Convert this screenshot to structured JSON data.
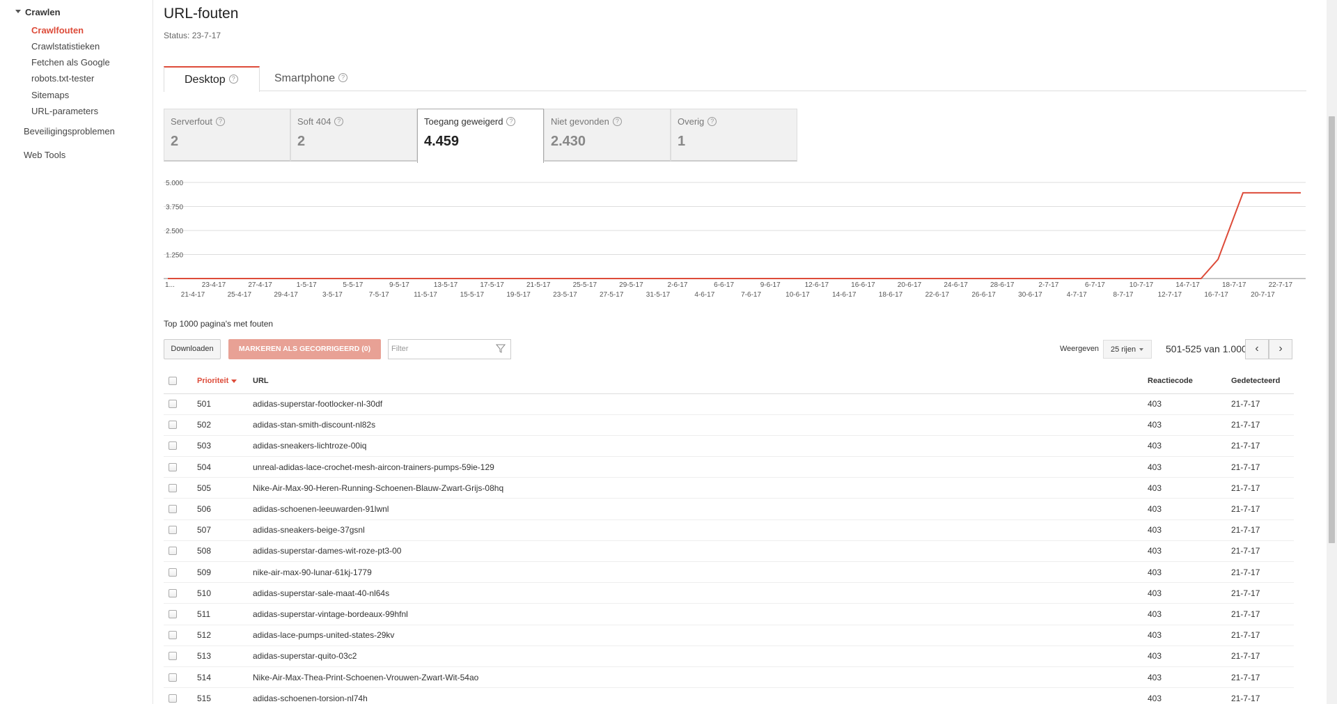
{
  "sidebar": {
    "group": "Crawlen",
    "items": [
      "Crawlfouten",
      "Crawlstatistieken",
      "Fetchen als Google",
      "robots.txt-tester",
      "Sitemaps",
      "URL-parameters"
    ],
    "security": "Beveiligingsproblemen",
    "webtools": "Web Tools"
  },
  "page": {
    "title": "URL-fouten",
    "status": "Status: 23-7-17"
  },
  "tabs": [
    {
      "label": "Desktop"
    },
    {
      "label": "Smartphone"
    }
  ],
  "cards": [
    {
      "label": "Serverfout",
      "value": "2"
    },
    {
      "label": "Soft 404",
      "value": "2"
    },
    {
      "label": "Toegang geweigerd",
      "value": "4.459"
    },
    {
      "label": "Niet gevonden",
      "value": "2.430"
    },
    {
      "label": "Overig",
      "value": "1"
    }
  ],
  "chart_data": {
    "type": "line",
    "ylim": [
      0,
      5000
    ],
    "yticks": [
      "5.000",
      "3.750",
      "2.500",
      "1.250"
    ],
    "x_top": [
      "1...",
      "23-4-17",
      "27-4-17",
      "1-5-17",
      "5-5-17",
      "9-5-17",
      "13-5-17",
      "17-5-17",
      "21-5-17",
      "25-5-17",
      "29-5-17",
      "2-6-17",
      "6-6-17",
      "9-6-17",
      "12-6-17",
      "16-6-17",
      "20-6-17",
      "24-6-17",
      "28-6-17",
      "2-7-17",
      "6-7-17",
      "10-7-17",
      "14-7-17",
      "18-7-17",
      "22-7-17"
    ],
    "x_bottom": [
      "21-4-17",
      "25-4-17",
      "29-4-17",
      "3-5-17",
      "7-5-17",
      "11-5-17",
      "15-5-17",
      "19-5-17",
      "23-5-17",
      "27-5-17",
      "31-5-17",
      "4-6-17",
      "7-6-17",
      "10-6-17",
      "14-6-17",
      "18-6-17",
      "22-6-17",
      "26-6-17",
      "30-6-17",
      "4-7-17",
      "8-7-17",
      "12-7-17",
      "16-7-17",
      "20-7-17"
    ],
    "series": [
      {
        "color": "#dd4b39",
        "points": [
          {
            "x": 0,
            "y": 0
          },
          {
            "x": 0.889,
            "y": 0
          },
          {
            "x": 0.912,
            "y": 0
          },
          {
            "x": 0.927,
            "y": 1000
          },
          {
            "x": 0.949,
            "y": 4459
          },
          {
            "x": 1.0,
            "y": 4459
          }
        ]
      }
    ]
  },
  "top_label": "Top 1000 pagina's met fouten",
  "buttons": {
    "download": "Downloaden",
    "mark": "MARKEREN ALS GECORRIGEERD (0)"
  },
  "filter": {
    "placeholder": "Filter"
  },
  "pagination": {
    "label": "Weergeven",
    "rows": "25 rijen",
    "range": "501-525 van 1.000"
  },
  "table": {
    "headers": {
      "priority": "Prioriteit",
      "url": "URL",
      "code": "Reactiecode",
      "detected": "Gedetecteerd"
    },
    "rows": [
      {
        "priority": "501",
        "url": "adidas-superstar-footlocker-nl-30df",
        "code": "403",
        "detected": "21-7-17"
      },
      {
        "priority": "502",
        "url": "adidas-stan-smith-discount-nl82s",
        "code": "403",
        "detected": "21-7-17"
      },
      {
        "priority": "503",
        "url": "adidas-sneakers-lichtroze-00iq",
        "code": "403",
        "detected": "21-7-17"
      },
      {
        "priority": "504",
        "url": "unreal-adidas-lace-crochet-mesh-aircon-trainers-pumps-59ie-129",
        "code": "403",
        "detected": "21-7-17"
      },
      {
        "priority": "505",
        "url": "Nike-Air-Max-90-Heren-Running-Schoenen-Blauw-Zwart-Grijs-08hq",
        "code": "403",
        "detected": "21-7-17"
      },
      {
        "priority": "506",
        "url": "adidas-schoenen-leeuwarden-91lwnl",
        "code": "403",
        "detected": "21-7-17"
      },
      {
        "priority": "507",
        "url": "adidas-sneakers-beige-37gsnl",
        "code": "403",
        "detected": "21-7-17"
      },
      {
        "priority": "508",
        "url": "adidas-superstar-dames-wit-roze-pt3-00",
        "code": "403",
        "detected": "21-7-17"
      },
      {
        "priority": "509",
        "url": "nike-air-max-90-lunar-61kj-1779",
        "code": "403",
        "detected": "21-7-17"
      },
      {
        "priority": "510",
        "url": "adidas-superstar-sale-maat-40-nl64s",
        "code": "403",
        "detected": "21-7-17"
      },
      {
        "priority": "511",
        "url": "adidas-superstar-vintage-bordeaux-99hfnl",
        "code": "403",
        "detected": "21-7-17"
      },
      {
        "priority": "512",
        "url": "adidas-lace-pumps-united-states-29kv",
        "code": "403",
        "detected": "21-7-17"
      },
      {
        "priority": "513",
        "url": "adidas-superstar-quito-03c2",
        "code": "403",
        "detected": "21-7-17"
      },
      {
        "priority": "514",
        "url": "Nike-Air-Max-Thea-Print-Schoenen-Vrouwen-Zwart-Wit-54ao",
        "code": "403",
        "detected": "21-7-17"
      },
      {
        "priority": "515",
        "url": "adidas-schoenen-torsion-nl74h",
        "code": "403",
        "detected": "21-7-17"
      }
    ]
  }
}
